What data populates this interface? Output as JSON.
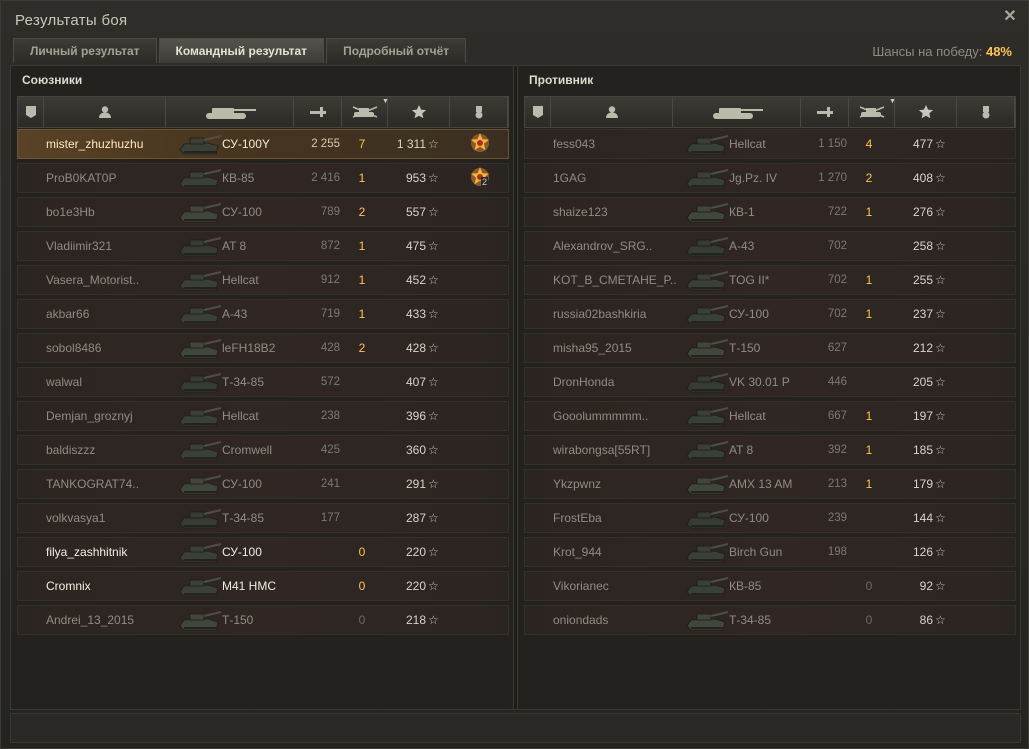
{
  "window": {
    "title": "Результаты боя"
  },
  "tabs": [
    {
      "label": "Личный результат",
      "active": false
    },
    {
      "label": "Командный результат",
      "active": true
    },
    {
      "label": "Подробный отчёт",
      "active": false
    }
  ],
  "chance": {
    "label": "Шансы на победу:",
    "value": "48%"
  },
  "allies": {
    "title": "Союзники",
    "players": [
      {
        "name": "mister_zhuzhuzhu",
        "tank": "СУ-100Y",
        "damage": "2 255",
        "kills": "7",
        "xp": "1 311",
        "medal": true,
        "medal_count": "",
        "self": true
      },
      {
        "name": "ProB0KAT0P",
        "tank": "КВ-85",
        "damage": "2 416",
        "kills": "1",
        "xp": "953",
        "medal": true,
        "medal_count": "2"
      },
      {
        "name": "bo1e3Hb",
        "tank": "СУ-100",
        "damage": "789",
        "kills": "2",
        "xp": "557"
      },
      {
        "name": "Vladiimir321",
        "tank": "AT 8",
        "damage": "872",
        "kills": "1",
        "xp": "475"
      },
      {
        "name": "Vasera_Motorist..",
        "tank": "Hellcat",
        "damage": "912",
        "kills": "1",
        "xp": "452"
      },
      {
        "name": "akbar66",
        "tank": "А-43",
        "damage": "719",
        "kills": "1",
        "xp": "433"
      },
      {
        "name": "sobol8486",
        "tank": "leFH18B2",
        "damage": "428",
        "kills": "2",
        "xp": "428"
      },
      {
        "name": "walwal",
        "tank": "Т-34-85",
        "damage": "572",
        "kills": "",
        "xp": "407"
      },
      {
        "name": "Demjan_groznyj",
        "tank": "Hellcat",
        "damage": "238",
        "kills": "",
        "xp": "396"
      },
      {
        "name": "baldiszzz",
        "tank": "Cromwell",
        "damage": "425",
        "kills": "",
        "xp": "360"
      },
      {
        "name": "TANKOGRAT74..",
        "tank": "СУ-100",
        "damage": "241",
        "kills": "",
        "xp": "291"
      },
      {
        "name": "volkvasya1",
        "tank": "Т-34-85",
        "damage": "177",
        "kills": "",
        "xp": "287"
      },
      {
        "name": "filya_zashhitnik",
        "tank": "СУ-100",
        "damage": "",
        "kills": "0",
        "xp": "220",
        "bright": true
      },
      {
        "name": "Cromnix",
        "tank": "M41 HMC",
        "damage": "",
        "kills": "0",
        "xp": "220",
        "bright": true
      },
      {
        "name": "Andrei_13_2015",
        "tank": "Т-150",
        "damage": "",
        "kills": "0",
        "xp": "218"
      }
    ]
  },
  "enemies": {
    "title": "Противник",
    "players": [
      {
        "name": "fess043",
        "tank": "Hellcat",
        "damage": "1 150",
        "kills": "4",
        "xp": "477"
      },
      {
        "name": "1GAG",
        "tank": "Jg.Pz. IV",
        "damage": "1 270",
        "kills": "2",
        "xp": "408"
      },
      {
        "name": "shaize123",
        "tank": "КВ-1",
        "damage": "722",
        "kills": "1",
        "xp": "276"
      },
      {
        "name": "Alexandrov_SRG..",
        "tank": "А-43",
        "damage": "702",
        "kills": "",
        "xp": "258"
      },
      {
        "name": "KOT_B_CMETAHE_P..",
        "tank": "TOG II*",
        "damage": "702",
        "kills": "1",
        "xp": "255"
      },
      {
        "name": "russia02bashkiria",
        "tank": "СУ-100",
        "damage": "702",
        "kills": "1",
        "xp": "237"
      },
      {
        "name": "misha95_2015",
        "tank": "Т-150",
        "damage": "627",
        "kills": "",
        "xp": "212"
      },
      {
        "name": "DronHonda",
        "tank": "VK 30.01 P",
        "damage": "446",
        "kills": "",
        "xp": "205"
      },
      {
        "name": "Gooolummmmm..",
        "tank": "Hellcat",
        "damage": "667",
        "kills": "1",
        "xp": "197"
      },
      {
        "name": "wirabongsa[55RT]",
        "tank": "AT 8",
        "damage": "392",
        "kills": "1",
        "xp": "185"
      },
      {
        "name": "Ykzpwnz",
        "tank": "AMX 13 AM",
        "damage": "213",
        "kills": "1",
        "xp": "179"
      },
      {
        "name": "FrostEba",
        "tank": "СУ-100",
        "damage": "239",
        "kills": "",
        "xp": "144"
      },
      {
        "name": "Krot_944",
        "tank": "Birch Gun",
        "damage": "198",
        "kills": "",
        "xp": "126"
      },
      {
        "name": "Vikorianec",
        "tank": "КВ-85",
        "damage": "",
        "kills": "0",
        "xp": "92"
      },
      {
        "name": "oniondads",
        "tank": "Т-34-85",
        "damage": "",
        "kills": "0",
        "xp": "86"
      }
    ]
  },
  "colors": {
    "accent": "#ffc34e",
    "self_row": "#5a4226",
    "row": "#302624"
  },
  "icons": [
    "close-icon",
    "squad-icon",
    "player-icon",
    "tank-icon",
    "damage-icon",
    "kills-icon",
    "xp-star-icon",
    "medal-icon"
  ]
}
